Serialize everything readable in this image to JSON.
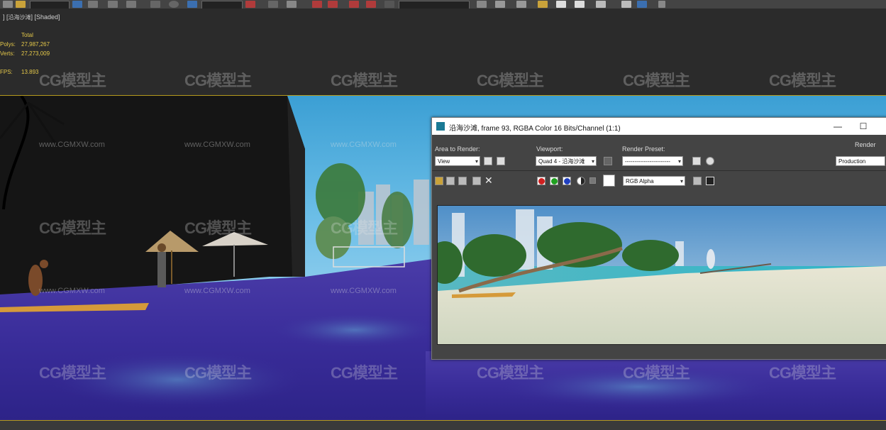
{
  "viewport": {
    "label_prefix": "] [",
    "name": "沿海沙滩",
    "label_suffix": "] [Shaded]"
  },
  "stats": {
    "header": "Total",
    "rows": [
      {
        "key": "Polys:",
        "value": "27,987,267"
      },
      {
        "key": "Verts:",
        "value": "27,273,009"
      }
    ],
    "fps_key": "FPS:",
    "fps_value": "13.893"
  },
  "watermark": {
    "logo_text": "CG模型主",
    "url": "www.CGMXW.com"
  },
  "render_window": {
    "title": "沿海沙滩, frame 93, RGBA Color 16 Bits/Channel (1:1)",
    "minimize": "—",
    "maximize": "☐",
    "area_to_render_label": "Area to Render:",
    "area_to_render_value": "View",
    "viewport_label": "Viewport:",
    "viewport_value": "Quad 4 - 沿海沙滩",
    "render_preset_label": "Render Preset:",
    "render_preset_value": "------------------------",
    "render_label": "Render",
    "render_mode_value": "Production",
    "channel_value": "RGB Alpha"
  },
  "colors": {
    "accent_yellow": "#b59a1d",
    "stats_yellow": "#e4c84a",
    "water_purple": "#3a2d9a"
  }
}
